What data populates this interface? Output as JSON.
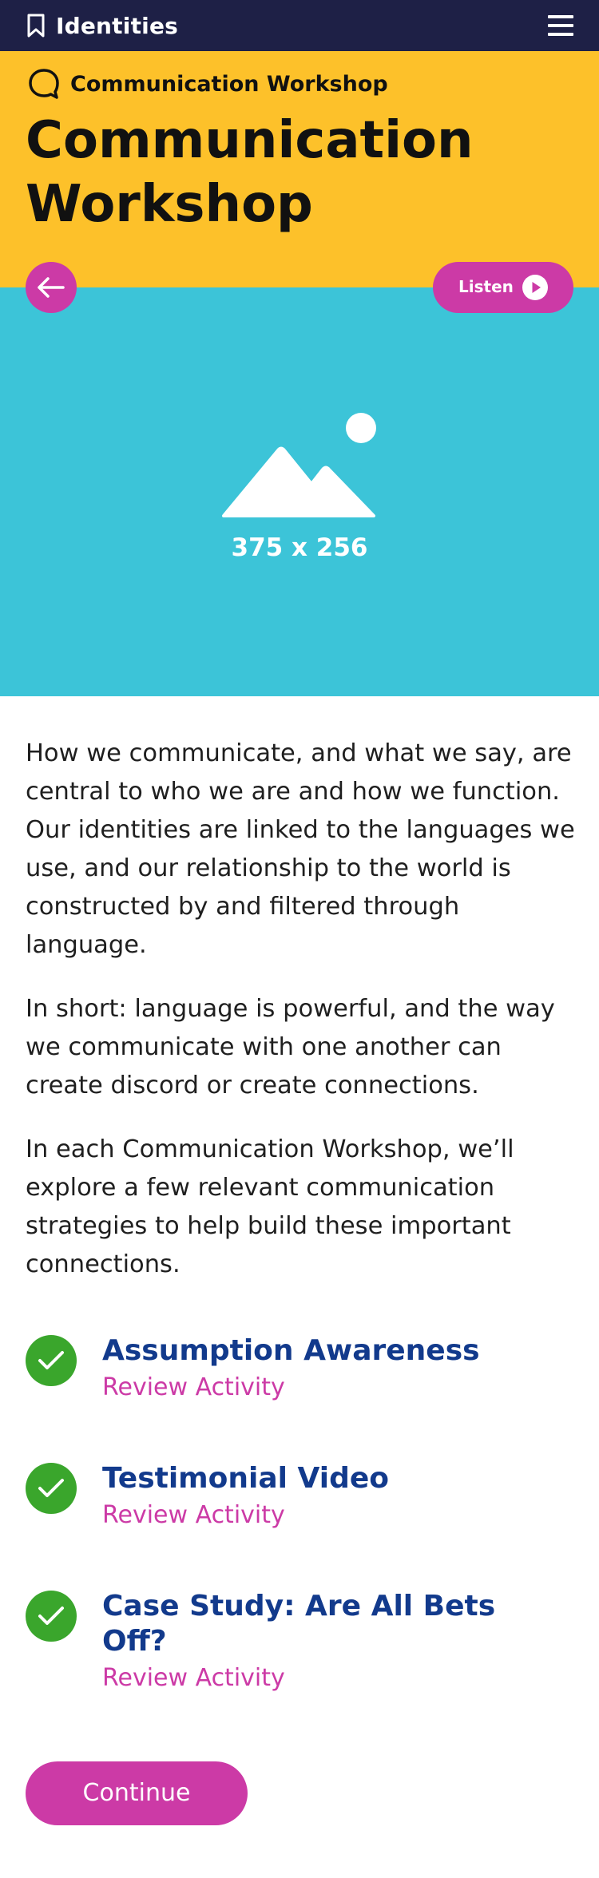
{
  "topbar": {
    "brand_icon": "bookmark-icon",
    "brand": "Identities",
    "menu_icon": "hamburger-menu-icon"
  },
  "header": {
    "crumb_icon": "speech-bubble-icon",
    "crumb": "Communication Workshop",
    "title": "Communication Workshop",
    "background": "#fdc12a"
  },
  "controls": {
    "back_icon": "arrow-left-icon",
    "listen": "Listen",
    "play_icon": "play-icon"
  },
  "hero": {
    "caption": "375 x 256",
    "icon": "image-placeholder-icon",
    "background": "#3cc4d8"
  },
  "content": {
    "paragraphs": [
      "How we communicate, and what we say, are central to who we are and how we function. Our identities are linked to the languages we use, and our relationship to the world is constructed by and filtered through language.",
      "In short: language is powerful, and the way we communicate with one another can create discord or create connections.",
      "In each Communication Workshop, we’ll explore a few relevant communication strategies to help build these important connections."
    ]
  },
  "activities": [
    {
      "title": "Assumption Awareness",
      "link": "Review Activity",
      "status_icon": "checkmark-icon"
    },
    {
      "title": "Testimonial Video",
      "link": "Review Activity",
      "status_icon": "checkmark-icon"
    },
    {
      "title": "Case Study: Are All Bets Off?",
      "link": "Review Activity",
      "status_icon": "checkmark-icon"
    }
  ],
  "continue": "Continue",
  "colors": {
    "navy": "#1e2046",
    "accent": "#cc3aa6",
    "title_blue": "#123a8c",
    "success": "#3aa62c"
  }
}
